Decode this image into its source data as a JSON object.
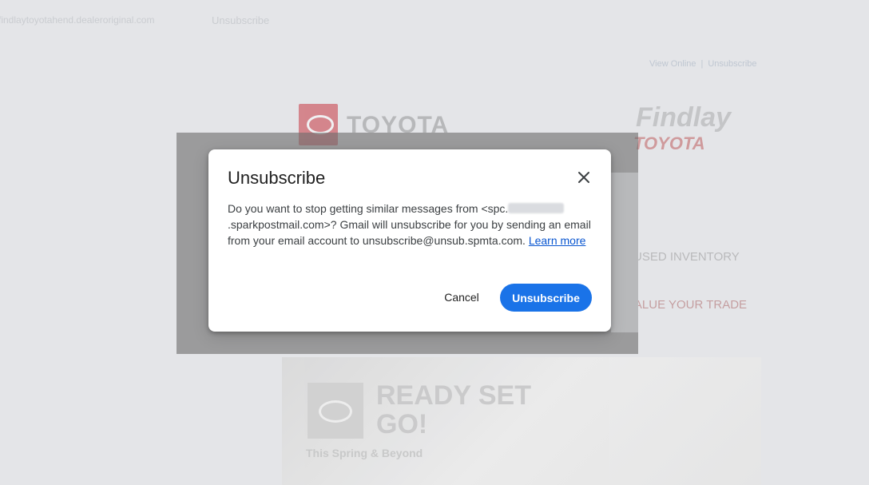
{
  "background": {
    "sender_line": "findlaytoyotahend.dealeroriginal.com",
    "top_unsubscribe_link": "Unsubscribe",
    "view_online_link": "View Online",
    "separator": "|",
    "email_unsubscribe_link": "Unsubscribe",
    "brand_text": "TOYOTA",
    "dealer_logo_text": "Findlay",
    "dealer_logo_sub": "TOYOTA",
    "nav_used_inventory": "USED INVENTORY",
    "nav_value_trade": "VALUE YOUR TRADE",
    "hero_title_line1": "READY SET",
    "hero_title_line2": "GO!",
    "hero_subtitle": "This Spring & Beyond"
  },
  "dialog": {
    "title": "Unsubscribe",
    "body_part1": "Do you want to stop getting similar messages from <spc.",
    "body_part2": ".sparkpostmail.com>? Gmail will unsubscribe for you by sending an email from your email account to unsubscribe@unsub.spmta.com.",
    "learn_more": "Learn more",
    "cancel_label": "Cancel",
    "unsubscribe_label": "Unsubscribe",
    "close_icon": "close-icon"
  },
  "colors": {
    "primary_button": "#1a73e8",
    "link": "#0b57d0",
    "overlay": "rgba(110,110,110,0.62)"
  }
}
